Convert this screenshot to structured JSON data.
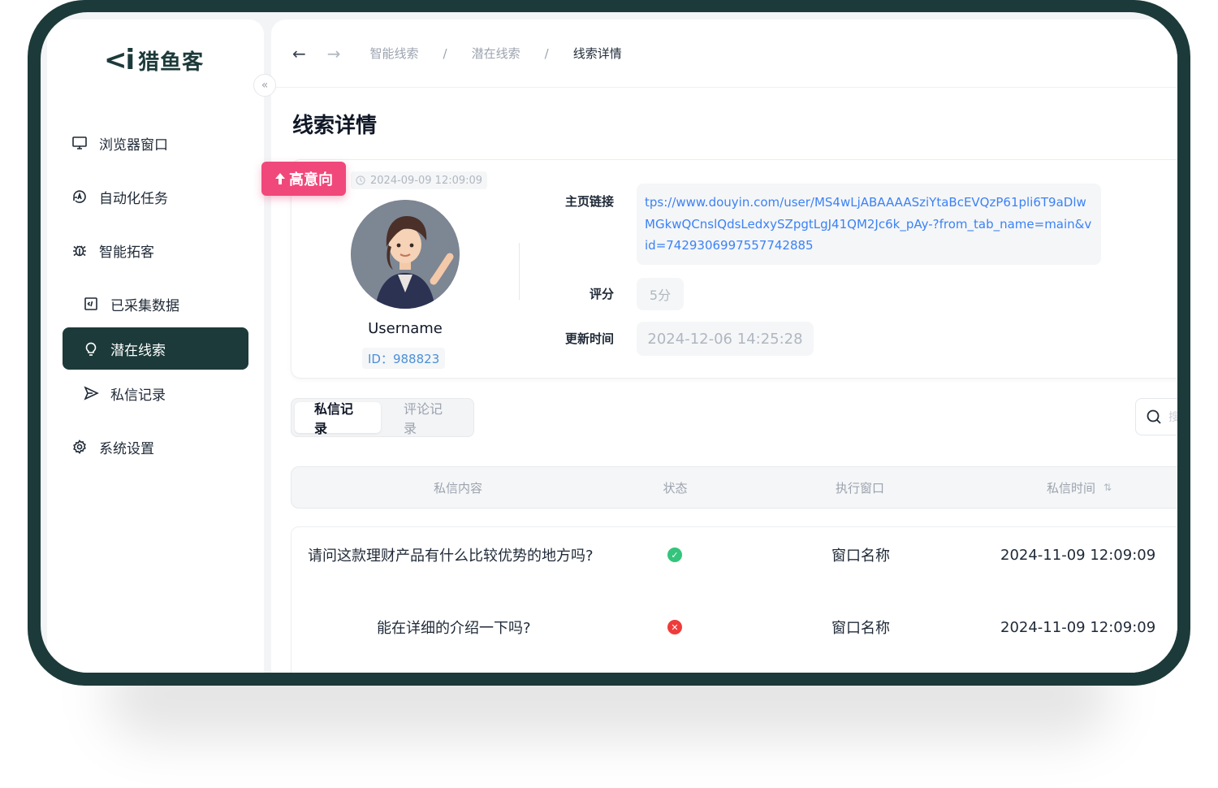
{
  "app": {
    "logo_mark": "<i",
    "logo_text": "猎鱼客"
  },
  "sidebar": {
    "collapse_icon": "«",
    "items": [
      {
        "label": "浏览器窗口",
        "icon": "monitor-icon"
      },
      {
        "label": "自动化任务",
        "icon": "automation-icon"
      },
      {
        "label": "智能拓客",
        "icon": "bug-icon"
      },
      {
        "label": "已采集数据",
        "icon": "code-file-icon"
      },
      {
        "label": "潜在线索",
        "icon": "lightbulb-icon",
        "active": true
      },
      {
        "label": "私信记录",
        "icon": "send-icon"
      },
      {
        "label": "系统设置",
        "icon": "gear-icon"
      }
    ]
  },
  "topbar": {
    "back": "←",
    "forward": "→",
    "breadcrumb": [
      "智能线索",
      "潜在线索",
      "线索详情"
    ],
    "separator": "/"
  },
  "page": {
    "title": "线索详情"
  },
  "lead": {
    "intent_badge": "高意向",
    "created_time": "2024-09-09 12:09:09",
    "username": "Username",
    "id_text": "ID：988823",
    "homepage_label": "主页链接",
    "homepage_url": "tps://www.douyin.com/user/MS4wLjABAAAASziYtaBcEVQzP61pli6T9aDlwMGkwQCnslQdsLedxySZpgtLgJ41QM2Jc6k_pAy-?from_tab_name=main&vid=7429306997557742885",
    "score_label": "评分",
    "score_value": "5分",
    "updated_label": "更新时间",
    "updated_value": "2024-12-06 14:25:28"
  },
  "tabs": [
    {
      "label": "私信记录",
      "active": true
    },
    {
      "label": "评论记录",
      "active": false
    }
  ],
  "search": {
    "placeholder": "搜"
  },
  "table": {
    "columns": [
      "私信内容",
      "状态",
      "执行窗口",
      "私信时间"
    ],
    "sort_icon": "⇅",
    "rows": [
      {
        "content": "请问这款理财产品有什么比较优势的地方吗?",
        "status": "success",
        "window": "窗口名称",
        "time": "2024-11-09 12:09:09"
      },
      {
        "content": "能在详细的介绍一下吗?",
        "status": "failed",
        "window": "窗口名称",
        "time": "2024-11-09 12:09:09"
      }
    ]
  },
  "colors": {
    "brand": "#1d3a3a",
    "badge": "#f0487a",
    "link": "#3b82f6",
    "success": "#34c47c",
    "error": "#ef3b3b"
  }
}
